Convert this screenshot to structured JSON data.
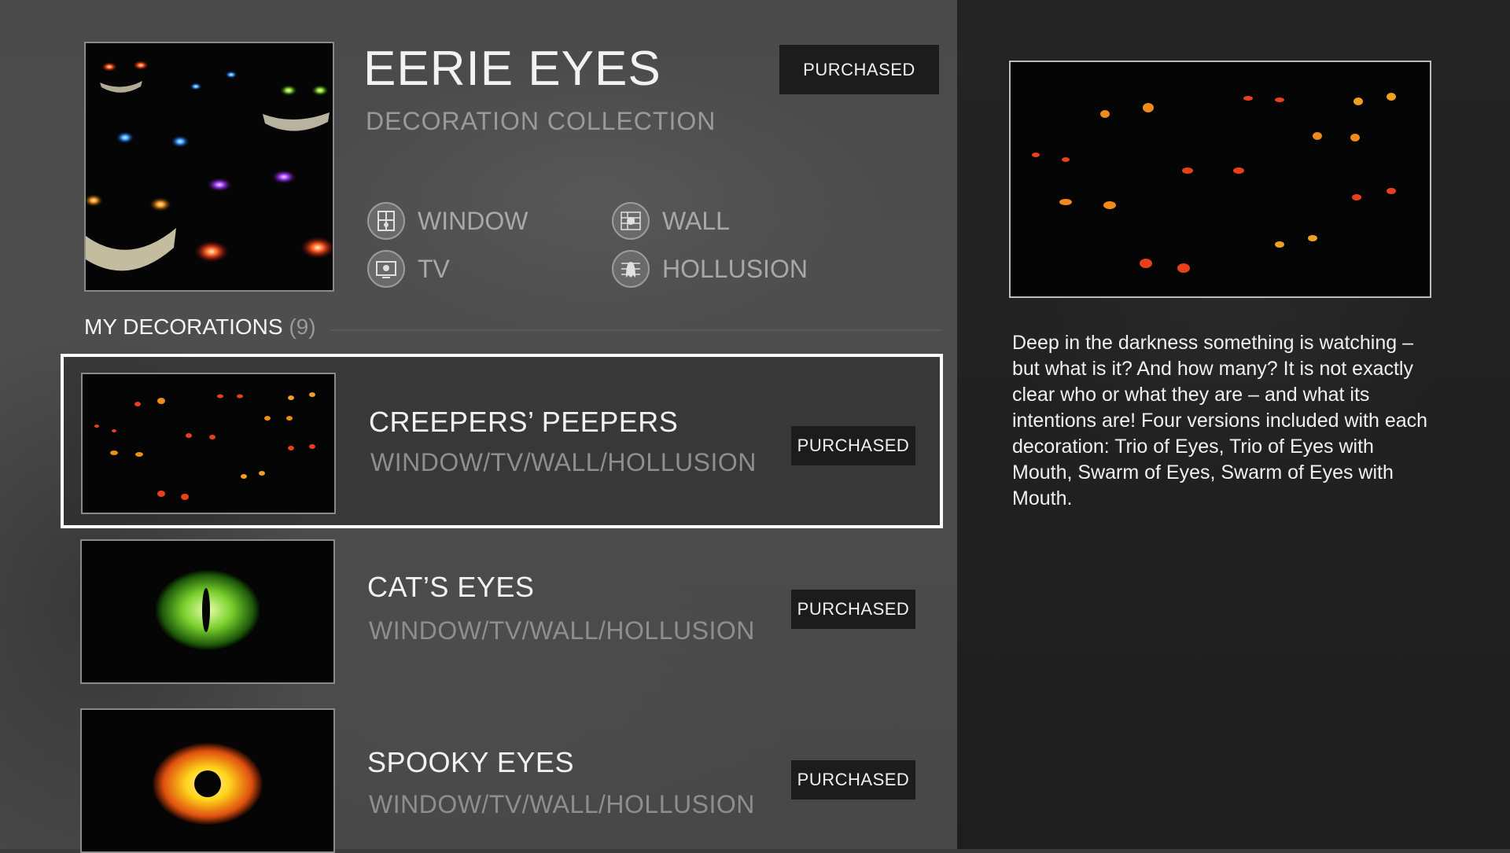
{
  "collection": {
    "title": "EERIE EYES",
    "subtitle": "DECORATION COLLECTION",
    "status": "PURCHASED",
    "locations": [
      {
        "label": "WINDOW",
        "icon": "window-icon"
      },
      {
        "label": "WALL",
        "icon": "wall-icon"
      },
      {
        "label": "TV",
        "icon": "tv-icon"
      },
      {
        "label": "HOLLUSION",
        "icon": "hollusion-icon"
      }
    ]
  },
  "my_decorations": {
    "label": "MY DECORATIONS",
    "count": "(9)"
  },
  "decorations": [
    {
      "title": "CREEPERS’ PEEPERS",
      "subtitle": "WINDOW/TV/WALL/HOLLUSION",
      "status": "PURCHASED",
      "selected": true
    },
    {
      "title": "CAT’S EYES",
      "subtitle": "WINDOW/TV/WALL/HOLLUSION",
      "status": "PURCHASED",
      "selected": false
    },
    {
      "title": "SPOOKY EYES",
      "subtitle": "WINDOW/TV/WALL/HOLLUSION",
      "status": "PURCHASED",
      "selected": false
    }
  ],
  "detail": {
    "description": "Deep in the darkness something is watching – but what is it? And how many? It is not exactly clear who or what they are – and what its intentions are! Four versions included with each decoration: Trio of Eyes, Trio of Eyes with Mouth, Swarm of Eyes, Swarm of Eyes with Mouth."
  },
  "colors": {
    "accent_eye_red": "#e8401c",
    "accent_eye_orange": "#f08a1a",
    "cat_eye_green": "#7ad12e",
    "spooky_eye_yellow": "#ffd21a",
    "badge_bg": "#1c1c1c",
    "selection_border": "#ffffff"
  }
}
